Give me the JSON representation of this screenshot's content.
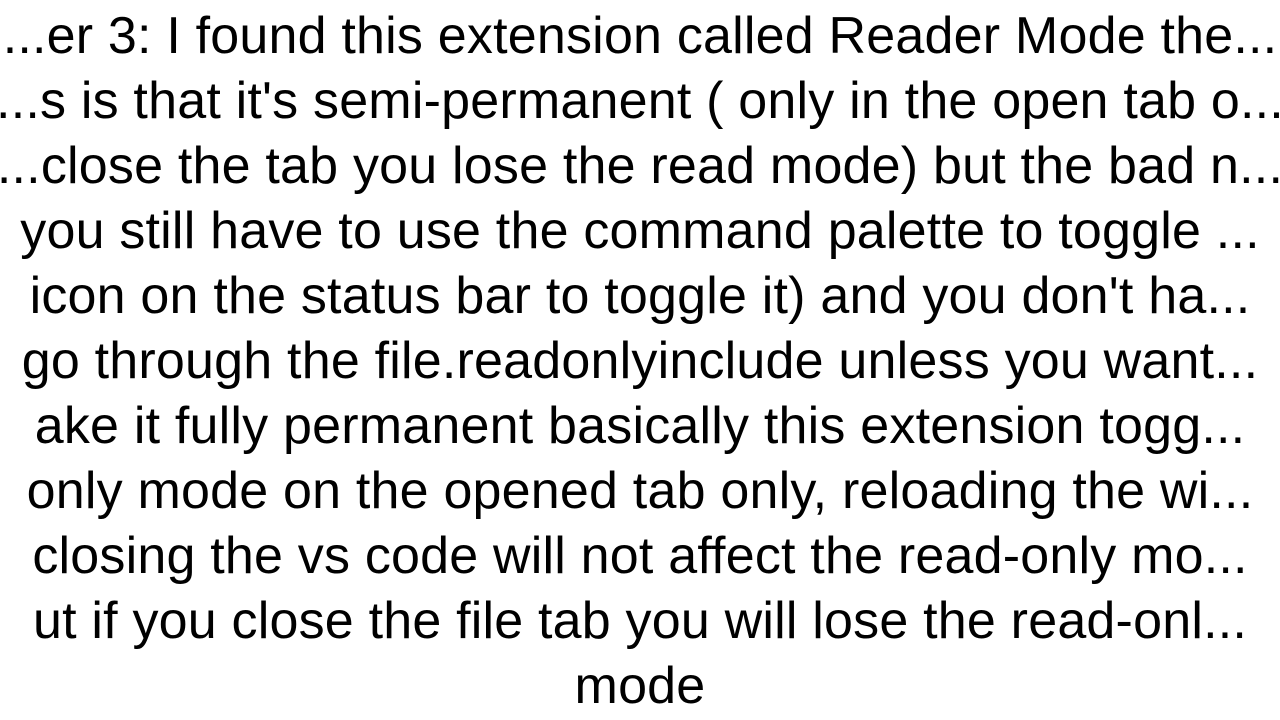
{
  "paragraph": {
    "text": "...er 3: I found this extension called Reader Mode the...\n...s is that it's semi-permanent ( only in the open tab o...\n...close the tab you lose the read mode) but the bad n...\nyou still have to use the command palette to toggle ...\nicon on the status bar to toggle it) and you don't ha...\ngo through the file.readonlyinclude unless you want...\nake it fully permanent basically this extension togg...\nonly mode on the opened tab only, reloading the wi...\nclosing the vs code will not affect the read-only mo...\nut if you close the file tab you will lose the read-onl...\nmode"
  },
  "context": {
    "topic": "VS Code Reader Mode extension",
    "answer_number": 3,
    "mentions": [
      "Reader Mode",
      "command palette",
      "status bar",
      "file.readonlyinclude",
      "read-only mode",
      "vs code"
    ]
  }
}
